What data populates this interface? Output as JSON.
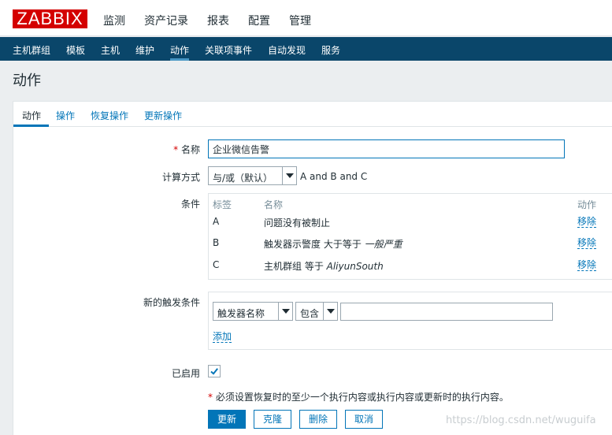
{
  "brand": {
    "logo": "ZABBIX",
    "logo_color": "#d40000"
  },
  "top_menu": [
    {
      "label": "监测"
    },
    {
      "label": "资产记录"
    },
    {
      "label": "报表"
    },
    {
      "label": "配置",
      "selected": true
    },
    {
      "label": "管理"
    }
  ],
  "sub_menu": [
    {
      "label": "主机群组"
    },
    {
      "label": "模板"
    },
    {
      "label": "主机"
    },
    {
      "label": "维护"
    },
    {
      "label": "动作",
      "selected": true
    },
    {
      "label": "关联项事件"
    },
    {
      "label": "自动发现"
    },
    {
      "label": "服务"
    }
  ],
  "page_title": "动作",
  "tabs": [
    {
      "label": "动作",
      "active": true
    },
    {
      "label": "操作"
    },
    {
      "label": "恢复操作"
    },
    {
      "label": "更新操作"
    }
  ],
  "form": {
    "required_mark": "*",
    "name_label": "名称",
    "name_value": "企业微信告警",
    "calc_label": "计算方式",
    "calc_value": "与/或（默认）",
    "calc_formula": "A and B and C",
    "conditions_label": "条件",
    "conditions": {
      "headers": {
        "tag": "标签",
        "name": "名称",
        "action": "动作"
      },
      "rows": [
        {
          "tag": "A",
          "name": "问题没有被制止",
          "name_italic": "",
          "action": "移除"
        },
        {
          "tag": "B",
          "name": "触发器示警度 大于等于 ",
          "name_italic": "一般严重",
          "action": "移除"
        },
        {
          "tag": "C",
          "name": "主机群组 等于 ",
          "name_italic": "AliyunSouth",
          "action": "移除"
        }
      ]
    },
    "new_condition_label": "新的触发条件",
    "new_condition": {
      "type_value": "触发器名称",
      "operator_value": "包含",
      "value": "",
      "add_label": "添加"
    },
    "enabled_label": "已启用",
    "enabled": true,
    "note": "必须设置恢复时的至少一个执行内容或执行内容或更新时的执行内容。"
  },
  "buttons": {
    "update": "更新",
    "clone": "克隆",
    "delete": "删除",
    "cancel": "取消"
  },
  "watermark": "https://blog.csdn.net/wuguifa",
  "colors": {
    "accent": "#0275b8",
    "nav": "#0a466a",
    "background": "#ebeef0"
  }
}
